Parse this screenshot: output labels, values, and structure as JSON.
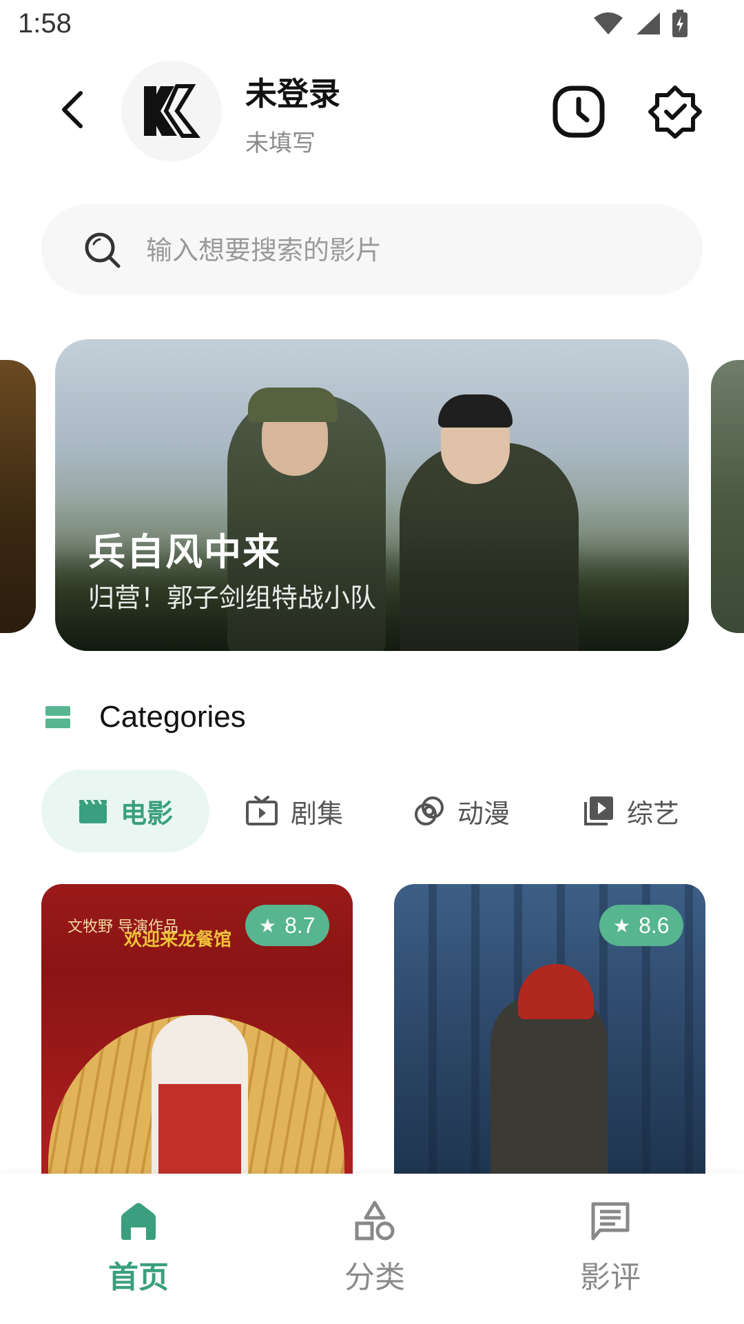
{
  "status_bar": {
    "time": "1:58"
  },
  "header": {
    "logo_letter": "K",
    "user_name": "未登录",
    "user_subtitle": "未填写"
  },
  "search": {
    "placeholder": "输入想要搜索的影片"
  },
  "banner": {
    "title": "兵自风中来",
    "subtitle": "归营！郭子剑组特战小队"
  },
  "categories": {
    "heading": "Categories",
    "tabs": [
      {
        "label": "电影",
        "icon": "clapperboard-icon",
        "active": true
      },
      {
        "label": "剧集",
        "icon": "tv-icon",
        "active": false
      },
      {
        "label": "动漫",
        "icon": "rings-icon",
        "active": false
      },
      {
        "label": "综艺",
        "icon": "video-library-icon",
        "active": false
      }
    ]
  },
  "movies": [
    {
      "rating": "8.7",
      "poster_caption_left": "文牧野 导演作品",
      "poster_title": "欢迎来龙餐馆"
    },
    {
      "rating": "8.6"
    }
  ],
  "bottom_nav": {
    "items": [
      {
        "label": "首页",
        "icon": "home-icon",
        "active": true
      },
      {
        "label": "分类",
        "icon": "shapes-icon",
        "active": false
      },
      {
        "label": "影评",
        "icon": "comment-icon",
        "active": false
      }
    ]
  },
  "colors": {
    "accent": "#3a9f7f",
    "rating_badge": "#57b58f",
    "active_tab_bg": "#e9f6f1"
  }
}
